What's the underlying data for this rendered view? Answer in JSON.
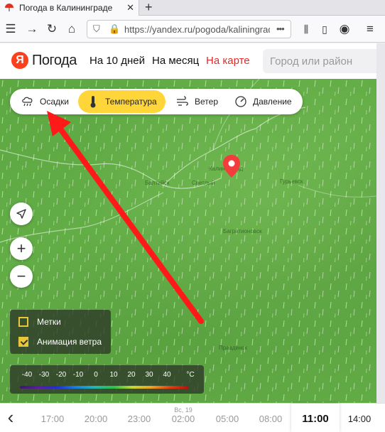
{
  "browser": {
    "tab_title": "Погода в Калининграде",
    "new_tab": "+",
    "close_tab": "✕",
    "url": "https://yandex.ru/pogoda/kaliningrad"
  },
  "header": {
    "logo_letter": "Я",
    "logo_name": "Погода",
    "nav": [
      "На 10 дней",
      "На месяц",
      "На карте"
    ],
    "city_placeholder": "Город или район"
  },
  "layers": [
    "Осадки",
    "Температура",
    "Ветер",
    "Давление"
  ],
  "active_layer": "Температура",
  "map_controls": {
    "zoom_in": "+",
    "zoom_out": "−"
  },
  "checkboxes": [
    {
      "label": "Метки",
      "checked": false
    },
    {
      "label": "Анимация ветра",
      "checked": true
    }
  ],
  "scale": {
    "ticks": [
      "-40",
      "-30",
      "-20",
      "-10",
      "0",
      "10",
      "20",
      "30",
      "40"
    ],
    "unit": "°C"
  },
  "map_labels": [
    "Калининград",
    "Светлый",
    "Балтийск",
    "Багратионовск",
    "Гурьевск",
    "Правдинск"
  ],
  "timeline": {
    "day_label": "Вс, 19",
    "times": [
      "17:00",
      "20:00",
      "23:00",
      "02:00",
      "05:00",
      "08:00",
      "11:00",
      "14:00"
    ],
    "current": "11:00"
  },
  "colors": {
    "accent": "#ffd63a",
    "brand": "#fc3f1d",
    "map_red_link": "#e52b2b",
    "arrow": "#ff1a1a"
  }
}
